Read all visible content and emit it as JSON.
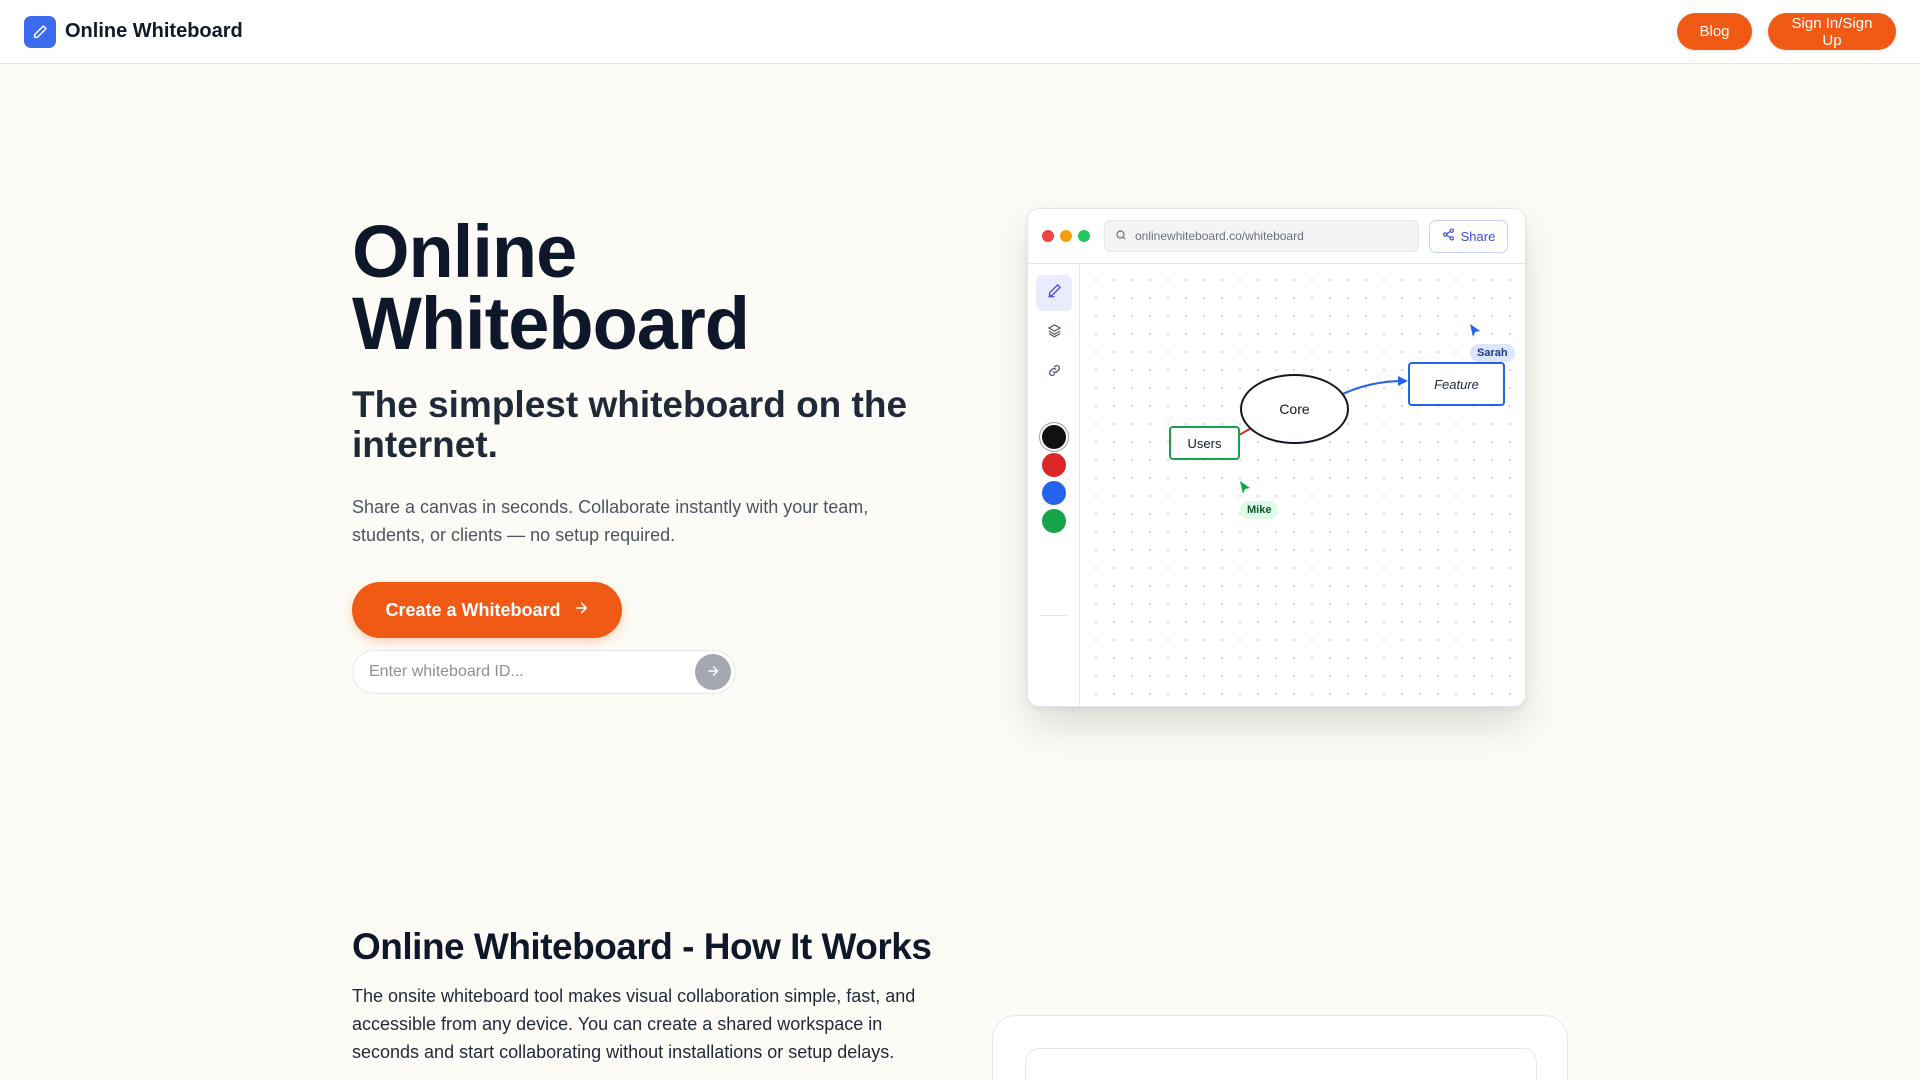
{
  "header": {
    "brand_name": "Online Whiteboard",
    "blog_label": "Blog",
    "signin_label": "Sign In/Sign Up"
  },
  "hero": {
    "title_line1": "Online",
    "title_line2": "Whiteboard",
    "subtitle": "The simplest whiteboard on the internet.",
    "description": "Share a canvas in seconds. Collaborate instantly with your team, students, or clients — no setup required.",
    "cta_label": "Create a Whiteboard",
    "id_placeholder": "Enter whiteboard ID..."
  },
  "mockup": {
    "url": "onlinewhiteboard.co/whiteboard",
    "share_label": "Share",
    "nodes": {
      "users": "Users",
      "core": "Core",
      "feature": "Feature"
    },
    "cursors": {
      "sarah": "Sarah",
      "mike": "Mike"
    },
    "swatch_colors": [
      "#111111",
      "#dc2626",
      "#2563eb",
      "#16a34a"
    ],
    "window_dot_colors": [
      "#ef4444",
      "#f59e0b",
      "#22c55e"
    ]
  },
  "how_it_works": {
    "title": "Online Whiteboard - How It Works",
    "description": "The onsite whiteboard tool makes visual collaboration simple, fast, and accessible from any device. You can create a shared workspace in seconds and start collaborating without installations or setup delays."
  },
  "colors": {
    "accent": "#f05a14",
    "brand_blue": "#3b6cf0",
    "background": "#fdfbf5"
  },
  "icons": [
    "pencil-icon",
    "arrow-right-icon",
    "search-icon",
    "share-icon",
    "layers-icon",
    "link-icon",
    "cursor-icon"
  ]
}
